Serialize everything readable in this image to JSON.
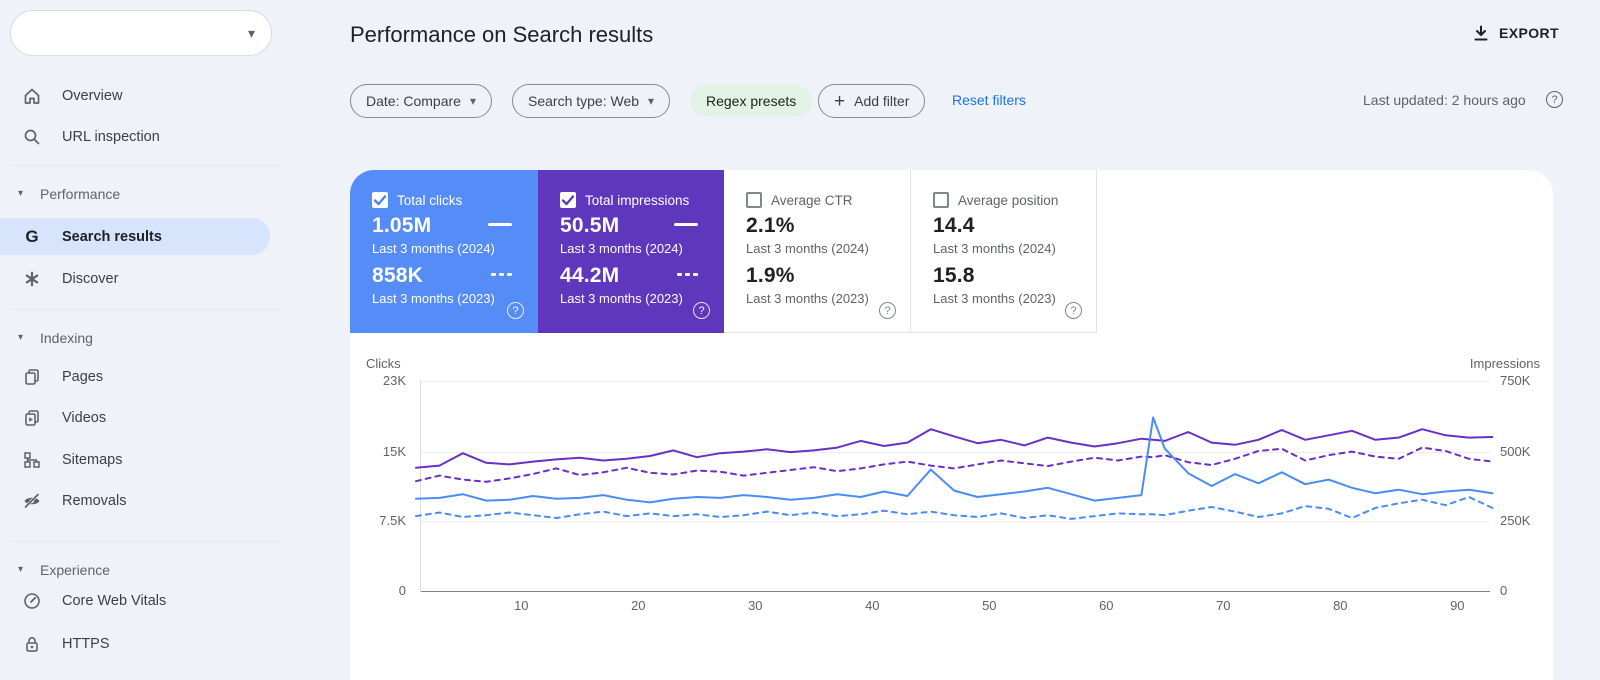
{
  "header": {
    "title": "Performance on Search results",
    "export_label": "EXPORT"
  },
  "filters": {
    "date_chip": "Date: Compare",
    "search_type_chip": "Search type: Web",
    "regex_chip": "Regex presets",
    "add_filter_chip": "Add filter",
    "reset_link": "Reset filters",
    "last_updated": "Last updated: 2 hours ago",
    "help_glyph": "?"
  },
  "sidebar": {
    "sections": [
      {
        "items": [
          {
            "label": "Overview",
            "icon": "home-icon"
          },
          {
            "label": "URL inspection",
            "icon": "search-icon"
          }
        ]
      },
      {
        "header": "Performance",
        "items": [
          {
            "label": "Search results",
            "icon": "google-g-icon",
            "selected": true
          },
          {
            "label": "Discover",
            "icon": "discover-icon"
          }
        ]
      },
      {
        "header": "Indexing",
        "items": [
          {
            "label": "Pages",
            "icon": "pages-icon"
          },
          {
            "label": "Videos",
            "icon": "videos-icon"
          },
          {
            "label": "Sitemaps",
            "icon": "sitemaps-icon"
          },
          {
            "label": "Removals",
            "icon": "removals-icon"
          }
        ]
      },
      {
        "header": "Experience",
        "items": [
          {
            "label": "Core Web Vitals",
            "icon": "gauge-icon"
          },
          {
            "label": "HTTPS",
            "icon": "lock-icon"
          }
        ]
      }
    ]
  },
  "cards": [
    {
      "label": "Total clicks",
      "checked": true,
      "color": "#558cf7",
      "rows": [
        {
          "value": "1.05M",
          "period": "Last 3 months (2024)"
        },
        {
          "value": "858K",
          "period": "Last 3 months (2023)"
        }
      ]
    },
    {
      "label": "Total impressions",
      "checked": true,
      "color": "#5f37bd",
      "rows": [
        {
          "value": "50.5M",
          "period": "Last 3 months (2024)"
        },
        {
          "value": "44.2M",
          "period": "Last 3 months (2023)"
        }
      ]
    },
    {
      "label": "Average CTR",
      "checked": false,
      "rows": [
        {
          "value": "2.1%",
          "period": "Last 3 months (2024)"
        },
        {
          "value": "1.9%",
          "period": "Last 3 months (2023)"
        }
      ]
    },
    {
      "label": "Average position",
      "checked": false,
      "rows": [
        {
          "value": "14.4",
          "period": "Last 3 months (2024)"
        },
        {
          "value": "15.8",
          "period": "Last 3 months (2023)"
        }
      ]
    }
  ],
  "chart_data": {
    "type": "line",
    "left_axis": {
      "title": "Clicks",
      "ticks": [
        "23K",
        "15K",
        "7.5K",
        "0"
      ],
      "max": 23
    },
    "right_axis": {
      "title": "Impressions",
      "ticks": [
        "750K",
        "500K",
        "250K",
        "0"
      ],
      "max": 750
    },
    "x_ticks": [
      10,
      20,
      30,
      40,
      50,
      60,
      70,
      80,
      90
    ],
    "x_range": [
      1,
      93
    ],
    "grid": true,
    "x": [
      1,
      3,
      5,
      7,
      9,
      11,
      13,
      15,
      17,
      19,
      21,
      23,
      25,
      27,
      29,
      31,
      33,
      35,
      37,
      39,
      41,
      43,
      45,
      47,
      49,
      51,
      53,
      55,
      57,
      59,
      61,
      63,
      64,
      65,
      67,
      69,
      71,
      73,
      75,
      77,
      79,
      81,
      83,
      85,
      87,
      89,
      91,
      93
    ],
    "series": [
      {
        "id": "impressions-2023",
        "name": "Total impressions - Last 3 months (2023)",
        "axis": "right",
        "style": "dashed",
        "color": "#6a2fc5",
        "values": [
          392,
          412,
          398,
          390,
          402,
          418,
          438,
          414,
          424,
          440,
          422,
          416,
          430,
          426,
          412,
          422,
          432,
          442,
          428,
          438,
          452,
          462,
          448,
          438,
          452,
          466,
          456,
          446,
          462,
          476,
          466,
          480,
          478,
          485,
          460,
          450,
          472,
          500,
          508,
          466,
          485,
          498,
          480,
          472,
          512,
          500,
          472,
          462
        ]
      },
      {
        "id": "clicks-2023",
        "name": "Total clicks - Last 3 months (2023)",
        "axis": "left",
        "style": "dashed",
        "color": "#4b8bf5",
        "values": [
          8.2,
          8.6,
          8.1,
          8.3,
          8.6,
          8.3,
          8.0,
          8.4,
          8.7,
          8.2,
          8.5,
          8.2,
          8.4,
          8.1,
          8.3,
          8.7,
          8.3,
          8.6,
          8.2,
          8.4,
          8.8,
          8.4,
          8.7,
          8.3,
          8.1,
          8.5,
          8.0,
          8.3,
          7.9,
          8.2,
          8.5,
          8.4,
          8.4,
          8.3,
          8.8,
          9.2,
          8.7,
          8.1,
          8.5,
          9.3,
          9.0,
          8.0,
          9.1,
          9.6,
          10.0,
          9.4,
          10.3,
          9.1
        ]
      },
      {
        "id": "impressions-2024",
        "name": "Total impressions - Last 3 months (2024)",
        "axis": "right",
        "style": "solid",
        "color": "#6a2fc5",
        "values": [
          440,
          448,
          492,
          458,
          452,
          462,
          470,
          476,
          466,
          472,
          482,
          502,
          478,
          492,
          498,
          506,
          496,
          502,
          512,
          536,
          518,
          530,
          578,
          552,
          528,
          540,
          520,
          548,
          530,
          516,
          528,
          544,
          540,
          536,
          568,
          530,
          522,
          540,
          575,
          540,
          556,
          572,
          540,
          548,
          578,
          556,
          548,
          550
        ]
      },
      {
        "id": "clicks-2024",
        "name": "Total clicks - Last 3 months (2024)",
        "axis": "left",
        "style": "solid",
        "color": "#4b8bf5",
        "values": [
          10.1,
          10.2,
          10.6,
          9.9,
          10.0,
          10.4,
          10.1,
          10.2,
          10.5,
          10.0,
          9.7,
          10.1,
          10.3,
          10.2,
          10.5,
          10.3,
          10.0,
          10.2,
          10.6,
          10.3,
          10.9,
          10.4,
          13.3,
          11.0,
          10.3,
          10.6,
          10.9,
          11.3,
          10.6,
          9.9,
          10.2,
          10.5,
          19.0,
          15.6,
          12.9,
          11.5,
          12.8,
          11.8,
          13.0,
          11.7,
          12.2,
          11.3,
          10.7,
          11.1,
          10.6,
          10.9,
          11.1,
          10.7
        ]
      }
    ]
  }
}
